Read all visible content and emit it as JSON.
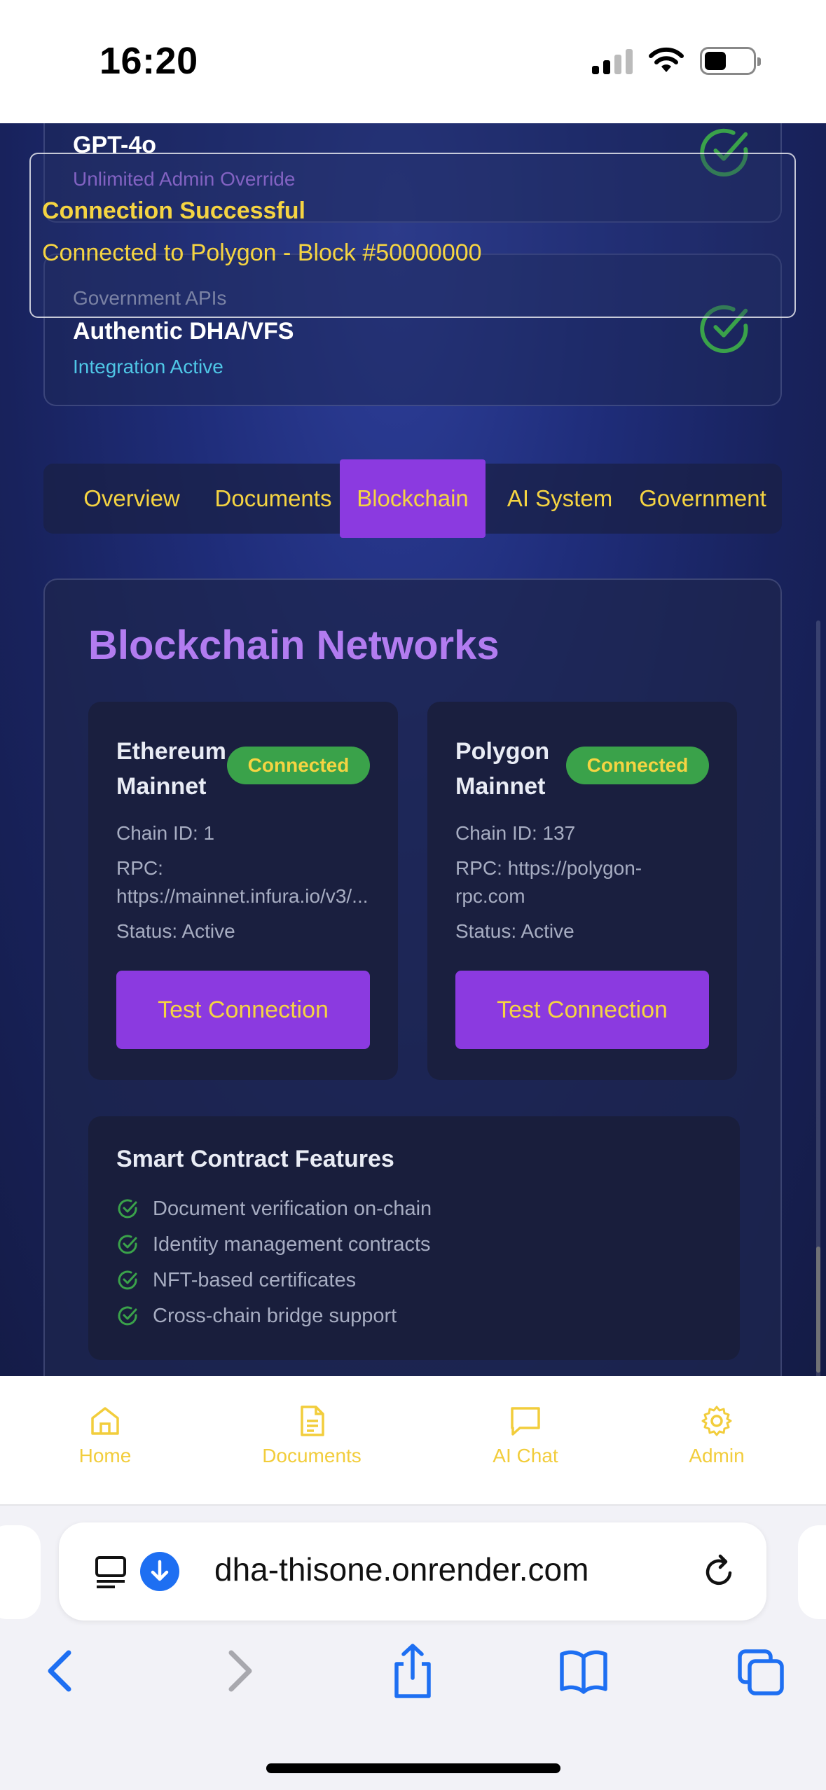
{
  "status_bar": {
    "time": "16:20"
  },
  "cards": {
    "ai": {
      "title": "GPT-4o",
      "subtitle": "Unlimited Admin Override"
    },
    "gov": {
      "label": "Government APIs",
      "title": "Authentic DHA/VFS",
      "subtitle": "Integration Active"
    }
  },
  "toast": {
    "title": "Connection Successful",
    "description": "Connected to Polygon - Block #50000000"
  },
  "tabs": [
    {
      "label": "Overview"
    },
    {
      "label": "Documents"
    },
    {
      "label": "Blockchain",
      "active": true
    },
    {
      "label": "AI System"
    },
    {
      "label": "Government"
    }
  ],
  "blockchain": {
    "title": "Blockchain Networks",
    "networks": [
      {
        "name": "Ethereum Mainnet",
        "badge": "Connected",
        "chain_id": "Chain ID: 1",
        "rpc_label": "RPC:",
        "rpc": "https://mainnet.infura.io/v3/...",
        "status": "Status: Active",
        "button": "Test Connection"
      },
      {
        "name": "Polygon Mainnet",
        "badge": "Connected",
        "chain_id": "Chain ID: 137",
        "rpc_label": "RPC: https://polygon-",
        "rpc": "rpc.com",
        "status": "Status: Active",
        "button": "Test Connection"
      }
    ],
    "features": {
      "title": "Smart Contract Features",
      "items": [
        "Document verification on-chain",
        "Identity management contracts",
        "NFT-based certificates",
        "Cross-chain bridge support"
      ]
    }
  },
  "bottom_nav": [
    {
      "label": "Home",
      "icon": "home-icon"
    },
    {
      "label": "Documents",
      "icon": "document-icon"
    },
    {
      "label": "AI Chat",
      "icon": "chat-icon"
    },
    {
      "label": "Admin",
      "icon": "gear-icon"
    }
  ],
  "browser": {
    "url": "dha-thisone.onrender.com"
  },
  "colors": {
    "accent_yellow": "#f5d442",
    "purple": "#8b3ae0",
    "success_green": "#3aa24a",
    "title_purple": "#b27cf0"
  }
}
